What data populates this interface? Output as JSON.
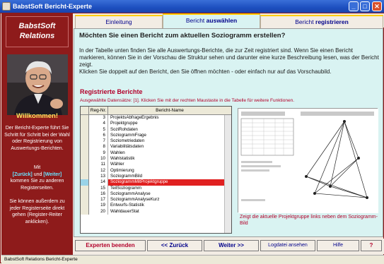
{
  "window": {
    "title": "BabstSoft Bericht-Experte"
  },
  "sidebar": {
    "brand_line1": "BabstSoft",
    "brand_line2": "Relations",
    "welcome": "Willkommen!",
    "para1": "Der Bericht-Experte führt Sie Schritt für Schritt bei der Wahl oder Registrierung von Auswertungs-Berichten.",
    "para2_pre": "Mit",
    "para2_back": "[Zurück]",
    "para2_and": "und",
    "para2_next": "[Weiter]",
    "para2_post": "kommen Sie zu anderen Registerseiten.",
    "para3": "Sie können außerdem zu jeder Registerseite direkt gehen (Register-Reiter anklicken)."
  },
  "tabs": [
    {
      "label": "Einleitung",
      "bold": ""
    },
    {
      "label": "Bericht ",
      "bold": "auswählen"
    },
    {
      "label": "Bericht ",
      "bold": "registrieren"
    }
  ],
  "main": {
    "question": "Möchten Sie einen Bericht zum aktuellen Soziogramm erstellen?",
    "description": "In der Tabelle unten finden Sie alle Auswertungs-Berichte, die zur Zeit registriert sind. Wenn Sie einen Bericht markieren, können Sie in der Vorschau die Struktur sehen und darunter eine kurze Beschreibung lesen, was der Bericht zeigt.",
    "description2": "Klicken Sie doppelt auf den Bericht, den Sie öffnen möchten - oder einfach nur auf das Vorschaubild.",
    "registered_title": "Registrierte Berichte",
    "registered_sub": "Ausgewählte Datensätze: [1]. Klicken Sie mit der rechten Maustaste in die Tabelle für weitere Funktionen.",
    "preview_caption": "Zeigt die aktuelle Projektgruppe links neben dem Soziogramm-Bild"
  },
  "table": {
    "col_nr": "Reg-Nr.",
    "col_name": "Bericht-Name",
    "rows": [
      {
        "nr": "3",
        "name": "ProjektsAbfrageErgebnis"
      },
      {
        "nr": "4",
        "name": "Projektgruppe"
      },
      {
        "nr": "5",
        "name": "SoziRohdaten"
      },
      {
        "nr": "6",
        "name": "SoziogrammFrage"
      },
      {
        "nr": "7",
        "name": "Soziometriedaten"
      },
      {
        "nr": "8",
        "name": "Variabilitätsdaten"
      },
      {
        "nr": "9",
        "name": "Wahlen"
      },
      {
        "nr": "10",
        "name": "Wahlstatistik"
      },
      {
        "nr": "11",
        "name": "Wähler"
      },
      {
        "nr": "12",
        "name": "Optimierung"
      },
      {
        "nr": "13",
        "name": "SoziogrammBild"
      },
      {
        "nr": "14",
        "name": "SoziogrammMitProjektgruppe"
      },
      {
        "nr": "15",
        "name": "TeilSoziogramm"
      },
      {
        "nr": "16",
        "name": "SoziogrammAnalyse"
      },
      {
        "nr": "17",
        "name": "SoziogrammAnalyseKurz"
      },
      {
        "nr": "19",
        "name": "Entwurfs-Statistik"
      },
      {
        "nr": "20",
        "name": "WahldauerStat"
      }
    ],
    "selected_index": 11
  },
  "buttons": {
    "quit": "Experten beenden",
    "back": "<< Zurück",
    "next": "Weiter >>",
    "log": "Logdatei ansehen",
    "help": "Hilfe",
    "question": "?"
  },
  "status": "BabstSoft Relations Bericht-Experte",
  "colors": {
    "accent": "#8e1b1b",
    "selection": "#e02020",
    "link": "#00008b"
  }
}
